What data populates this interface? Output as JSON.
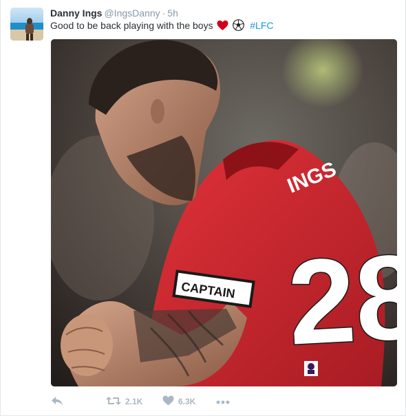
{
  "tweet": {
    "author_name": "Danny Ings",
    "handle": "@IngsDanny",
    "separator": "·",
    "time": "5h",
    "text": "Good to be back playing with the boys",
    "hashtag": "#LFC",
    "emojis": [
      "heart-icon",
      "soccer-ball-icon"
    ]
  },
  "media": {
    "armband_text": "CAPTAIN",
    "shirt_name": "INGS",
    "shirt_number": "28"
  },
  "actions": {
    "retweet_count": "2.1K",
    "like_count": "6.3K"
  },
  "colors": {
    "link": "#1b95e0",
    "muted": "#8899a6",
    "action_icon": "#aab8c2",
    "heart": "#e0245e",
    "jersey": "#d72f36"
  }
}
